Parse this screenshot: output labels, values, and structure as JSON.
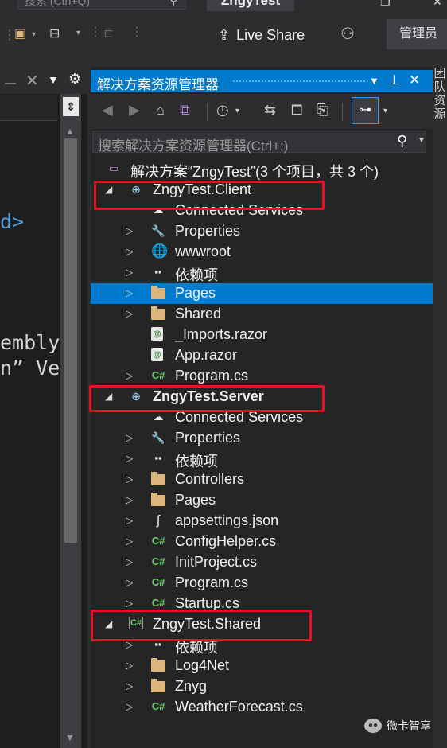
{
  "title_bar": {
    "search_placeholder": "搜索 (Ctrl+Q)",
    "app_title": "ZngyTest"
  },
  "toolbar": {
    "live_share_label": "Live Share",
    "admin_label": "管理员"
  },
  "editor": {
    "code_lines": [
      {
        "text": "d>",
        "color": "#569cd6"
      },
      {
        "text": "embly.",
        "color": "#d4d4d4"
      },
      {
        "text": "n” Ver",
        "color": "#d4d4d4"
      }
    ]
  },
  "solution_explorer": {
    "title": "解决方案资源管理器",
    "search_placeholder": "搜索解决方案资源管理器(Ctrl+;)",
    "side_tab_label": "团队资源",
    "tree": [
      {
        "label": "解决方案“ZngyTest”(3 个项目，共 3 个)",
        "icon": "solution-icon",
        "glyph": "▭",
        "expander": "",
        "level": 0
      },
      {
        "label": "ZngyTest.Client",
        "icon": "web-project-icon",
        "glyph": "⊕",
        "expander": "◢",
        "level": 1
      },
      {
        "label": "Connected Services",
        "icon": "connected-services-icon",
        "glyph": "☁",
        "expander": "",
        "level": 2
      },
      {
        "label": "Properties",
        "icon": "properties-icon",
        "glyph": "🔧",
        "expander": "▷",
        "level": 2
      },
      {
        "label": "wwwroot",
        "icon": "globe-icon",
        "glyph": "🌐",
        "expander": "▷",
        "level": 2
      },
      {
        "label": "依赖项",
        "icon": "dependencies-icon",
        "glyph": "▪▪",
        "expander": "▷",
        "level": 2
      },
      {
        "label": "Pages",
        "icon": "folder-icon",
        "glyph": "",
        "expander": "▷",
        "level": 2,
        "selected": true
      },
      {
        "label": "Shared",
        "icon": "folder-icon",
        "glyph": "",
        "expander": "▷",
        "level": 2
      },
      {
        "label": "_Imports.razor",
        "icon": "razor-file-icon",
        "glyph": "@",
        "expander": "",
        "level": 2
      },
      {
        "label": "App.razor",
        "icon": "razor-file-icon",
        "glyph": "@",
        "expander": "",
        "level": 2
      },
      {
        "label": "Program.cs",
        "icon": "csharp-file-icon",
        "glyph": "C#",
        "expander": "▷",
        "level": 2
      },
      {
        "label": "ZngyTest.Server",
        "icon": "web-project-icon",
        "glyph": "⊕",
        "expander": "◢",
        "level": 1,
        "bold": true
      },
      {
        "label": "Connected Services",
        "icon": "connected-services-icon",
        "glyph": "☁",
        "expander": "",
        "level": 2
      },
      {
        "label": "Properties",
        "icon": "properties-icon",
        "glyph": "🔧",
        "expander": "▷",
        "level": 2
      },
      {
        "label": "依赖项",
        "icon": "dependencies-icon",
        "glyph": "▪▪",
        "expander": "▷",
        "level": 2
      },
      {
        "label": "Controllers",
        "icon": "folder-icon",
        "glyph": "",
        "expander": "▷",
        "level": 2
      },
      {
        "label": "Pages",
        "icon": "folder-icon",
        "glyph": "",
        "expander": "▷",
        "level": 2
      },
      {
        "label": "appsettings.json",
        "icon": "json-file-icon",
        "glyph": "ʃ",
        "expander": "▷",
        "level": 2
      },
      {
        "label": "ConfigHelper.cs",
        "icon": "csharp-file-icon",
        "glyph": "C#",
        "expander": "▷",
        "level": 2
      },
      {
        "label": "InitProject.cs",
        "icon": "csharp-file-icon",
        "glyph": "C#",
        "expander": "▷",
        "level": 2
      },
      {
        "label": "Program.cs",
        "icon": "csharp-file-icon",
        "glyph": "C#",
        "expander": "▷",
        "level": 2
      },
      {
        "label": "Startup.cs",
        "icon": "csharp-file-icon",
        "glyph": "C#",
        "expander": "▷",
        "level": 2
      },
      {
        "label": "ZngyTest.Shared",
        "icon": "csharp-project-icon",
        "glyph": "C#",
        "expander": "◢",
        "level": 1
      },
      {
        "label": "依赖项",
        "icon": "dependencies-icon",
        "glyph": "▪▪",
        "expander": "▷",
        "level": 2
      },
      {
        "label": "Log4Net",
        "icon": "folder-icon",
        "glyph": "",
        "expander": "▷",
        "level": 2
      },
      {
        "label": "Znyg",
        "icon": "folder-icon",
        "glyph": "",
        "expander": "▷",
        "level": 2
      },
      {
        "label": "WeatherForecast.cs",
        "icon": "csharp-file-icon",
        "glyph": "C#",
        "expander": "▷",
        "level": 2
      }
    ]
  },
  "watermark": {
    "text": "微卡智享"
  },
  "colors": {
    "accent": "#007acc",
    "highlight_box": "#e81123",
    "background": "#252526"
  }
}
